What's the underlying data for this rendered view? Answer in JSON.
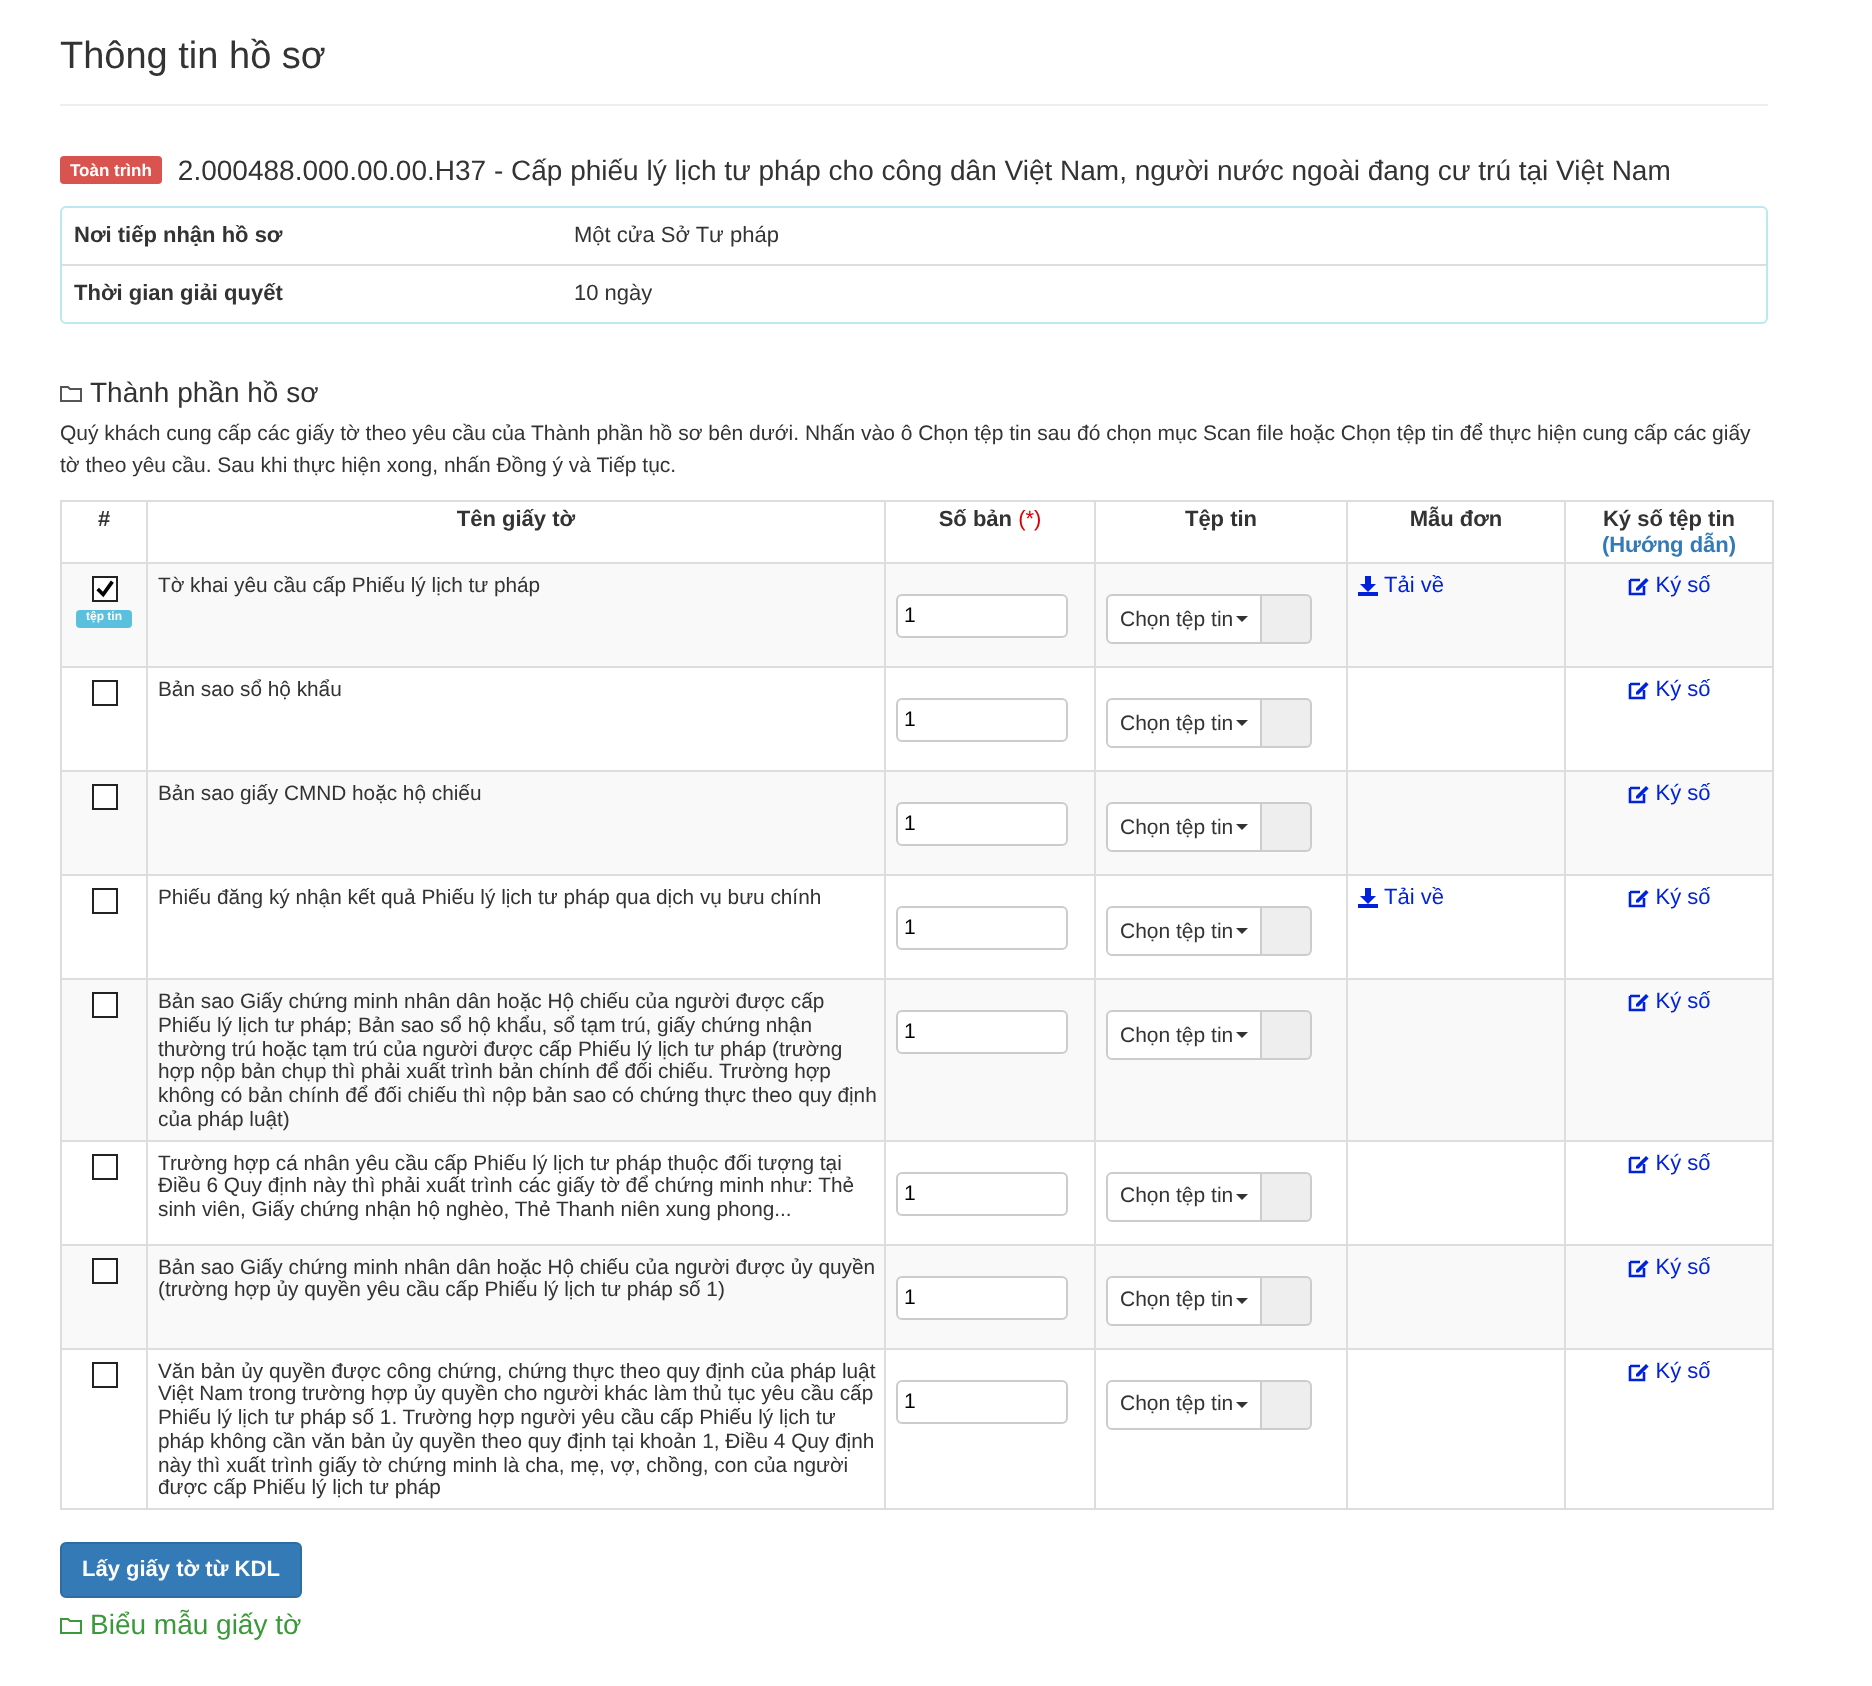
{
  "page_title": "Thông tin hồ sơ",
  "procedure": {
    "badge": "Toàn trình",
    "title": "2.000488.000.00.00.H37 - Cấp phiếu lý lịch tư pháp cho công dân Việt Nam, người nước ngoài đang cư trú tại Việt Nam"
  },
  "info_rows": [
    {
      "label": "Nơi tiếp nhận hồ sơ",
      "value": "Một cửa Sở Tư pháp"
    },
    {
      "label": "Thời gian giải quyết",
      "value": "10 ngày"
    }
  ],
  "section_title": "Thành phần hồ sơ",
  "instructions": "Quý khách cung cấp các giấy tờ theo yêu cầu của Thành phần hồ sơ bên dưới. Nhấn vào ô Chọn tệp tin sau đó chọn mục Scan file hoặc Chọn tệp tin để thực hiện cung cấp các giấy tờ theo yêu cầu. Sau khi thực hiện xong, nhấn Đồng ý và Tiếp tục.",
  "table": {
    "columns": [
      "#",
      "Tên giấy tờ",
      "Số bản",
      "Tệp tin",
      "Mẫu đơn",
      "Ký số tệp tin"
    ],
    "required_mark": "(*)",
    "guide_link": "(Hướng dẫn)",
    "rows": [
      {
        "checked": true,
        "file_badge": "tệp tin",
        "name": "Tờ khai yêu cầu cấp Phiếu lý lịch tư pháp",
        "copies": "1",
        "file_button": "Chọn tệp tin",
        "template_link": "Tải về",
        "sign_link": "Ký số"
      },
      {
        "checked": false,
        "name": "Bản sao sổ hộ khẩu",
        "copies": "1",
        "file_button": "Chọn tệp tin",
        "sign_link": "Ký số"
      },
      {
        "checked": false,
        "name": "Bản sao giấy CMND hoặc hộ chiếu",
        "copies": "1",
        "file_button": "Chọn tệp tin",
        "sign_link": "Ký số"
      },
      {
        "checked": false,
        "name": "Phiếu đăng ký nhận kết quả Phiếu lý lịch tư pháp qua dịch vụ bưu chính",
        "copies": "1",
        "file_button": "Chọn tệp tin",
        "template_link": "Tải về",
        "sign_link": "Ký số"
      },
      {
        "checked": false,
        "name": "Bản sao Giấy chứng minh nhân dân hoặc Hộ chiếu của người được cấp Phiếu lý lịch tư pháp; Bản sao sổ hộ khẩu, sổ tạm trú, giấy chứng nhận thường trú hoặc tạm trú của người được cấp Phiếu lý lịch tư pháp (trường hợp nộp bản chụp thì phải xuất trình bản chính để đối chiếu. Trường hợp không có bản chính để đối chiếu thì nộp bản sao có chứng thực theo quy định của pháp luật)",
        "copies": "1",
        "file_button": "Chọn tệp tin",
        "sign_link": "Ký số"
      },
      {
        "checked": false,
        "name": "Trường hợp cá nhân yêu cầu cấp Phiếu lý lịch tư pháp thuộc đối tượng tại Điều 6 Quy định này thì phải xuất trình các giấy tờ để chứng minh như: Thẻ sinh viên, Giấy chứng nhận hộ nghèo, Thẻ Thanh niên xung phong...",
        "copies": "1",
        "file_button": "Chọn tệp tin",
        "sign_link": "Ký số"
      },
      {
        "checked": false,
        "name": "Bản sao Giấy chứng minh nhân dân hoặc Hộ chiếu của người được ủy quyền (trường hợp ủy quyền yêu cầu cấp Phiếu lý lịch tư pháp số 1)",
        "copies": "1",
        "file_button": "Chọn tệp tin",
        "sign_link": "Ký số"
      },
      {
        "checked": false,
        "name": "Văn bản ủy quyền được công chứng, chứng thực theo quy định của pháp luật Việt Nam trong trường hợp ủy quyền cho người khác làm thủ tục yêu cầu cấp Phiếu lý lịch tư pháp số 1. Trường hợp người yêu cầu cấp Phiếu lý lịch tư pháp không cần văn bản ủy quyền theo quy định tại khoản 1, Điều 4 Quy định này thì xuất trình giấy tờ chứng minh là cha, mẹ, vợ, chồng, con của người được cấp Phiếu lý lịch tư pháp",
        "copies": "1",
        "file_button": "Chọn tệp tin",
        "sign_link": "Ký số"
      }
    ]
  },
  "fetch_button": "Lấy giấy tờ từ KDL",
  "forms_section_title": "Biểu mẫu giấy tờ"
}
